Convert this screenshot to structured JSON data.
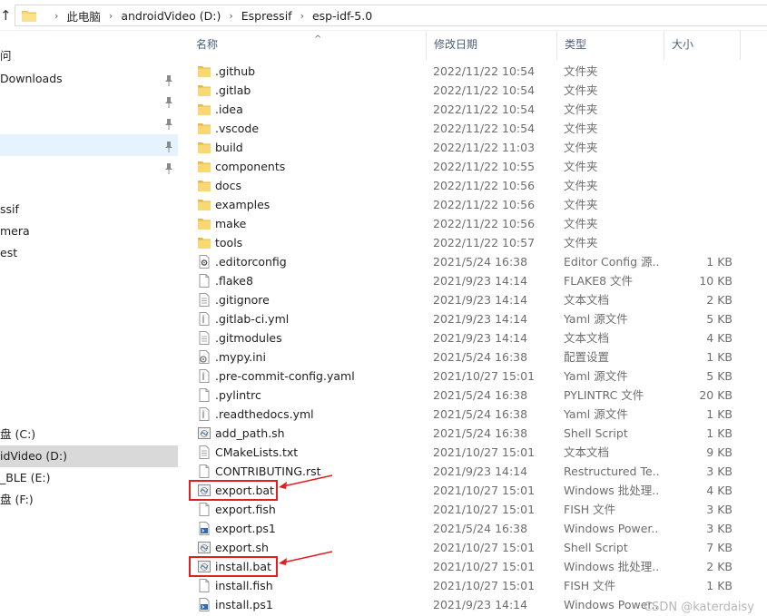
{
  "address": {
    "crumbs": [
      "此电脑",
      "androidVideo (D:)",
      "Espressif",
      "esp-idf-5.0"
    ]
  },
  "nav": {
    "items": [
      {
        "label": "问",
        "pinned": false
      },
      {
        "label": "Downloads",
        "pinned": true
      },
      {
        "label": "",
        "pinned": true
      },
      {
        "label": "",
        "pinned": true
      },
      {
        "label": "",
        "pinned": true,
        "selected": true
      },
      {
        "label": "",
        "pinned": true
      },
      {
        "label": "ssif",
        "pinned": false
      },
      {
        "label": "mera",
        "pinned": false
      },
      {
        "label": "est",
        "pinned": false
      },
      {
        "label": "盘 (C:)",
        "pinned": false
      },
      {
        "label": "idVideo (D:)",
        "pinned": false,
        "current": true
      },
      {
        "label": "_BLE (E:)",
        "pinned": false
      },
      {
        "label": "盘 (F:)",
        "pinned": false
      }
    ]
  },
  "columns": {
    "name": "名称",
    "date": "修改日期",
    "type": "类型",
    "size": "大小"
  },
  "files": [
    {
      "name": ".github",
      "date": "2022/11/22 10:54",
      "type": "文件夹",
      "size": "",
      "icon": "folder-icon"
    },
    {
      "name": ".gitlab",
      "date": "2022/11/22 10:54",
      "type": "文件夹",
      "size": "",
      "icon": "folder-icon"
    },
    {
      "name": ".idea",
      "date": "2022/11/22 10:54",
      "type": "文件夹",
      "size": "",
      "icon": "folder-icon"
    },
    {
      "name": ".vscode",
      "date": "2022/11/22 10:54",
      "type": "文件夹",
      "size": "",
      "icon": "folder-icon"
    },
    {
      "name": "build",
      "date": "2022/11/22 11:03",
      "type": "文件夹",
      "size": "",
      "icon": "folder-icon"
    },
    {
      "name": "components",
      "date": "2022/11/22 10:55",
      "type": "文件夹",
      "size": "",
      "icon": "folder-icon"
    },
    {
      "name": "docs",
      "date": "2022/11/22 10:56",
      "type": "文件夹",
      "size": "",
      "icon": "folder-icon"
    },
    {
      "name": "examples",
      "date": "2022/11/22 10:56",
      "type": "文件夹",
      "size": "",
      "icon": "folder-icon"
    },
    {
      "name": "make",
      "date": "2022/11/22 10:56",
      "type": "文件夹",
      "size": "",
      "icon": "folder-icon"
    },
    {
      "name": "tools",
      "date": "2022/11/22 10:57",
      "type": "文件夹",
      "size": "",
      "icon": "folder-icon"
    },
    {
      "name": ".editorconfig",
      "date": "2021/5/24 16:38",
      "type": "Editor Config 源...",
      "size": "1 KB",
      "icon": "config-file-icon"
    },
    {
      "name": ".flake8",
      "date": "2021/9/23 14:14",
      "type": "FLAKE8 文件",
      "size": "10 KB",
      "icon": "file-icon"
    },
    {
      "name": ".gitignore",
      "date": "2021/9/23 14:14",
      "type": "文本文档",
      "size": "2 KB",
      "icon": "text-file-icon"
    },
    {
      "name": ".gitlab-ci.yml",
      "date": "2021/9/23 14:14",
      "type": "Yaml 源文件",
      "size": "5 KB",
      "icon": "yaml-file-icon"
    },
    {
      "name": ".gitmodules",
      "date": "2021/9/23 14:14",
      "type": "文本文档",
      "size": "4 KB",
      "icon": "text-file-icon"
    },
    {
      "name": ".mypy.ini",
      "date": "2021/5/24 16:38",
      "type": "配置设置",
      "size": "1 KB",
      "icon": "settings-file-icon"
    },
    {
      "name": ".pre-commit-config.yaml",
      "date": "2021/10/27 15:01",
      "type": "Yaml 源文件",
      "size": "5 KB",
      "icon": "yaml-file-icon"
    },
    {
      "name": ".pylintrc",
      "date": "2021/5/24 16:38",
      "type": "PYLINTRC 文件",
      "size": "20 KB",
      "icon": "file-icon"
    },
    {
      "name": ".readthedocs.yml",
      "date": "2021/5/24 16:38",
      "type": "Yaml 源文件",
      "size": "1 KB",
      "icon": "yaml-file-icon"
    },
    {
      "name": "add_path.sh",
      "date": "2021/5/24 16:38",
      "type": "Shell Script",
      "size": "1 KB",
      "icon": "script-file-icon"
    },
    {
      "name": "CMakeLists.txt",
      "date": "2021/10/27 15:01",
      "type": "文本文档",
      "size": "9 KB",
      "icon": "text-file-icon"
    },
    {
      "name": "CONTRIBUTING.rst",
      "date": "2021/9/23 14:14",
      "type": "Restructured Te...",
      "size": "3 KB",
      "icon": "file-icon"
    },
    {
      "name": "export.bat",
      "date": "2021/10/27 15:01",
      "type": "Windows 批处理...",
      "size": "4 KB",
      "icon": "batch-file-icon",
      "highlight": true
    },
    {
      "name": "export.fish",
      "date": "2021/10/27 15:01",
      "type": "FISH 文件",
      "size": "3 KB",
      "icon": "file-icon"
    },
    {
      "name": "export.ps1",
      "date": "2021/5/24 16:38",
      "type": "Windows Power...",
      "size": "3 KB",
      "icon": "powershell-file-icon"
    },
    {
      "name": "export.sh",
      "date": "2021/10/27 15:01",
      "type": "Shell Script",
      "size": "7 KB",
      "icon": "script-file-icon"
    },
    {
      "name": "install.bat",
      "date": "2021/10/27 15:01",
      "type": "Windows 批处理...",
      "size": "2 KB",
      "icon": "batch-file-icon",
      "highlight": true
    },
    {
      "name": "install.fish",
      "date": "2021/10/27 15:01",
      "type": "FISH 文件",
      "size": "1 KB",
      "icon": "file-icon"
    },
    {
      "name": "install.ps1",
      "date": "2021/9/23 14:14",
      "type": "Windows Power...",
      "size": "",
      "icon": "powershell-file-icon"
    }
  ],
  "colors": {
    "selection": "#e5f3ff",
    "current_drive": "#d9d9d9",
    "folder": "#f8d775",
    "annotation": "#e02020"
  },
  "watermark": "CSDN @katerdaisy"
}
